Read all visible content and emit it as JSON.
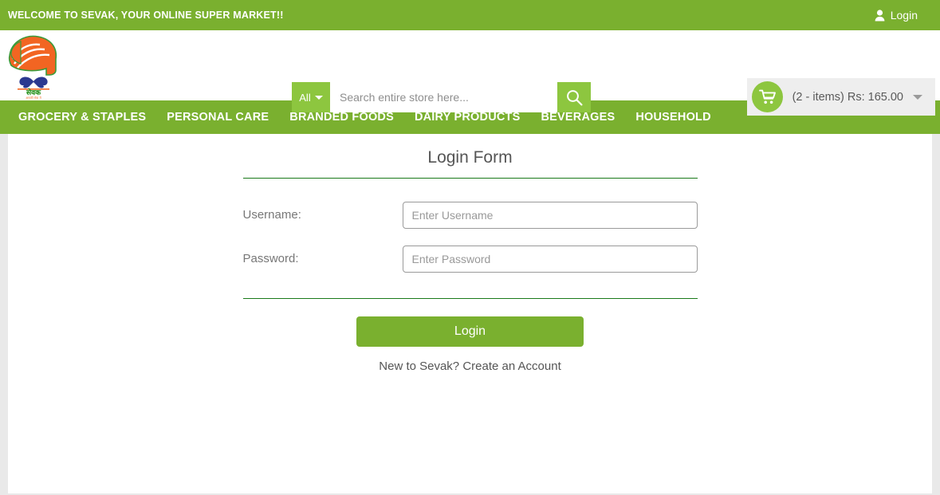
{
  "topbar": {
    "welcome": "WELCOME TO SEVAK, YOUR ONLINE SUPER MARKET!!",
    "login_label": "Login",
    "login_icon": "person-icon"
  },
  "header": {
    "logo_alt": "sevak-logo",
    "search": {
      "category_label": "All",
      "placeholder": "Search entire store here...",
      "value": "",
      "search_icon": "search-icon",
      "caret_icon": "chevron-down-icon"
    },
    "cart": {
      "icon": "shopping-cart-icon",
      "summary": "(2 - items) Rs: 165.00",
      "items_count": 2,
      "total": "Rs: 165.00",
      "caret_icon": "chevron-down-icon"
    }
  },
  "nav": {
    "items": [
      {
        "label": "GROCERY & STAPLES"
      },
      {
        "label": "PERSONAL CARE"
      },
      {
        "label": "BRANDED FOODS"
      },
      {
        "label": "DAIRY PRODUCTS"
      },
      {
        "label": "BEVERAGES"
      },
      {
        "label": "HOUSEHOLD"
      }
    ]
  },
  "form": {
    "title": "Login Form",
    "username": {
      "label": "Username:",
      "placeholder": "Enter Username",
      "value": ""
    },
    "password": {
      "label": "Password:",
      "placeholder": "Enter Password",
      "value": ""
    },
    "submit_label": "Login",
    "create_account_text": "New to Sevak? Create an Account"
  },
  "colors": {
    "brand_green": "#7ab02f",
    "accent_green": "#8dc63f",
    "rule_green": "#1a7a1a",
    "page_gray": "#e9e9e9"
  }
}
